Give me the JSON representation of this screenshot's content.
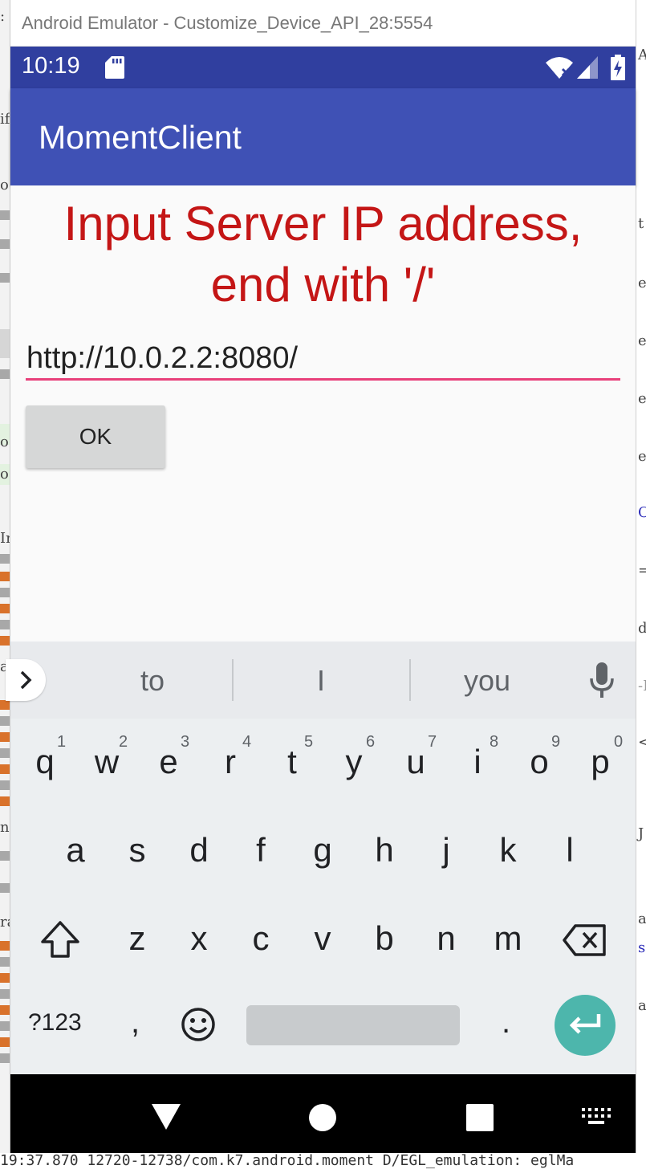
{
  "emulator": {
    "title": "Android Emulator - Customize_Device_API_28:5554"
  },
  "status_bar": {
    "time": "10:19",
    "icons": [
      "sd-card-icon",
      "wifi-icon",
      "signal-icon",
      "battery-icon"
    ]
  },
  "app": {
    "title": "MomentClient",
    "heading_line1": "Input Server IP address,",
    "heading_line2": "end with '/'",
    "ip_input_value": "http://10.0.2.2:8080/",
    "ok_button_label": "OK"
  },
  "keyboard": {
    "suggestions": [
      "to",
      "I",
      "you"
    ],
    "row1": [
      {
        "key": "q",
        "hint": "1"
      },
      {
        "key": "w",
        "hint": "2"
      },
      {
        "key": "e",
        "hint": "3"
      },
      {
        "key": "r",
        "hint": "4"
      },
      {
        "key": "t",
        "hint": "5"
      },
      {
        "key": "y",
        "hint": "6"
      },
      {
        "key": "u",
        "hint": "7"
      },
      {
        "key": "i",
        "hint": "8"
      },
      {
        "key": "o",
        "hint": "9"
      },
      {
        "key": "p",
        "hint": "0"
      }
    ],
    "row2": [
      "a",
      "s",
      "d",
      "f",
      "g",
      "h",
      "j",
      "k",
      "l"
    ],
    "row3": [
      "z",
      "x",
      "c",
      "v",
      "b",
      "n",
      "m"
    ],
    "symbols_label": "?123",
    "comma": ",",
    "period": "."
  },
  "background": {
    "left_fragments": [
      ":",
      "if",
      "o",
      "o",
      "o",
      "Ir",
      "ay",
      "n",
      "ra"
    ],
    "right_fragments": [
      "Ac",
      "t",
      "e",
      "e",
      "e",
      "e",
      "O",
      "=",
      "d",
      "-I",
      "<",
      "J",
      "a",
      "se",
      "a"
    ],
    "bottom_log": "19:37.870 12720-12738/com.k7.android.moment D/EGL_emulation: eglMa"
  },
  "colors": {
    "status_bar": "#303f9f",
    "app_bar": "#3f51b5",
    "heading": "#c41616",
    "input_underline": "#e8407a",
    "enter_key": "#4db6ac"
  }
}
